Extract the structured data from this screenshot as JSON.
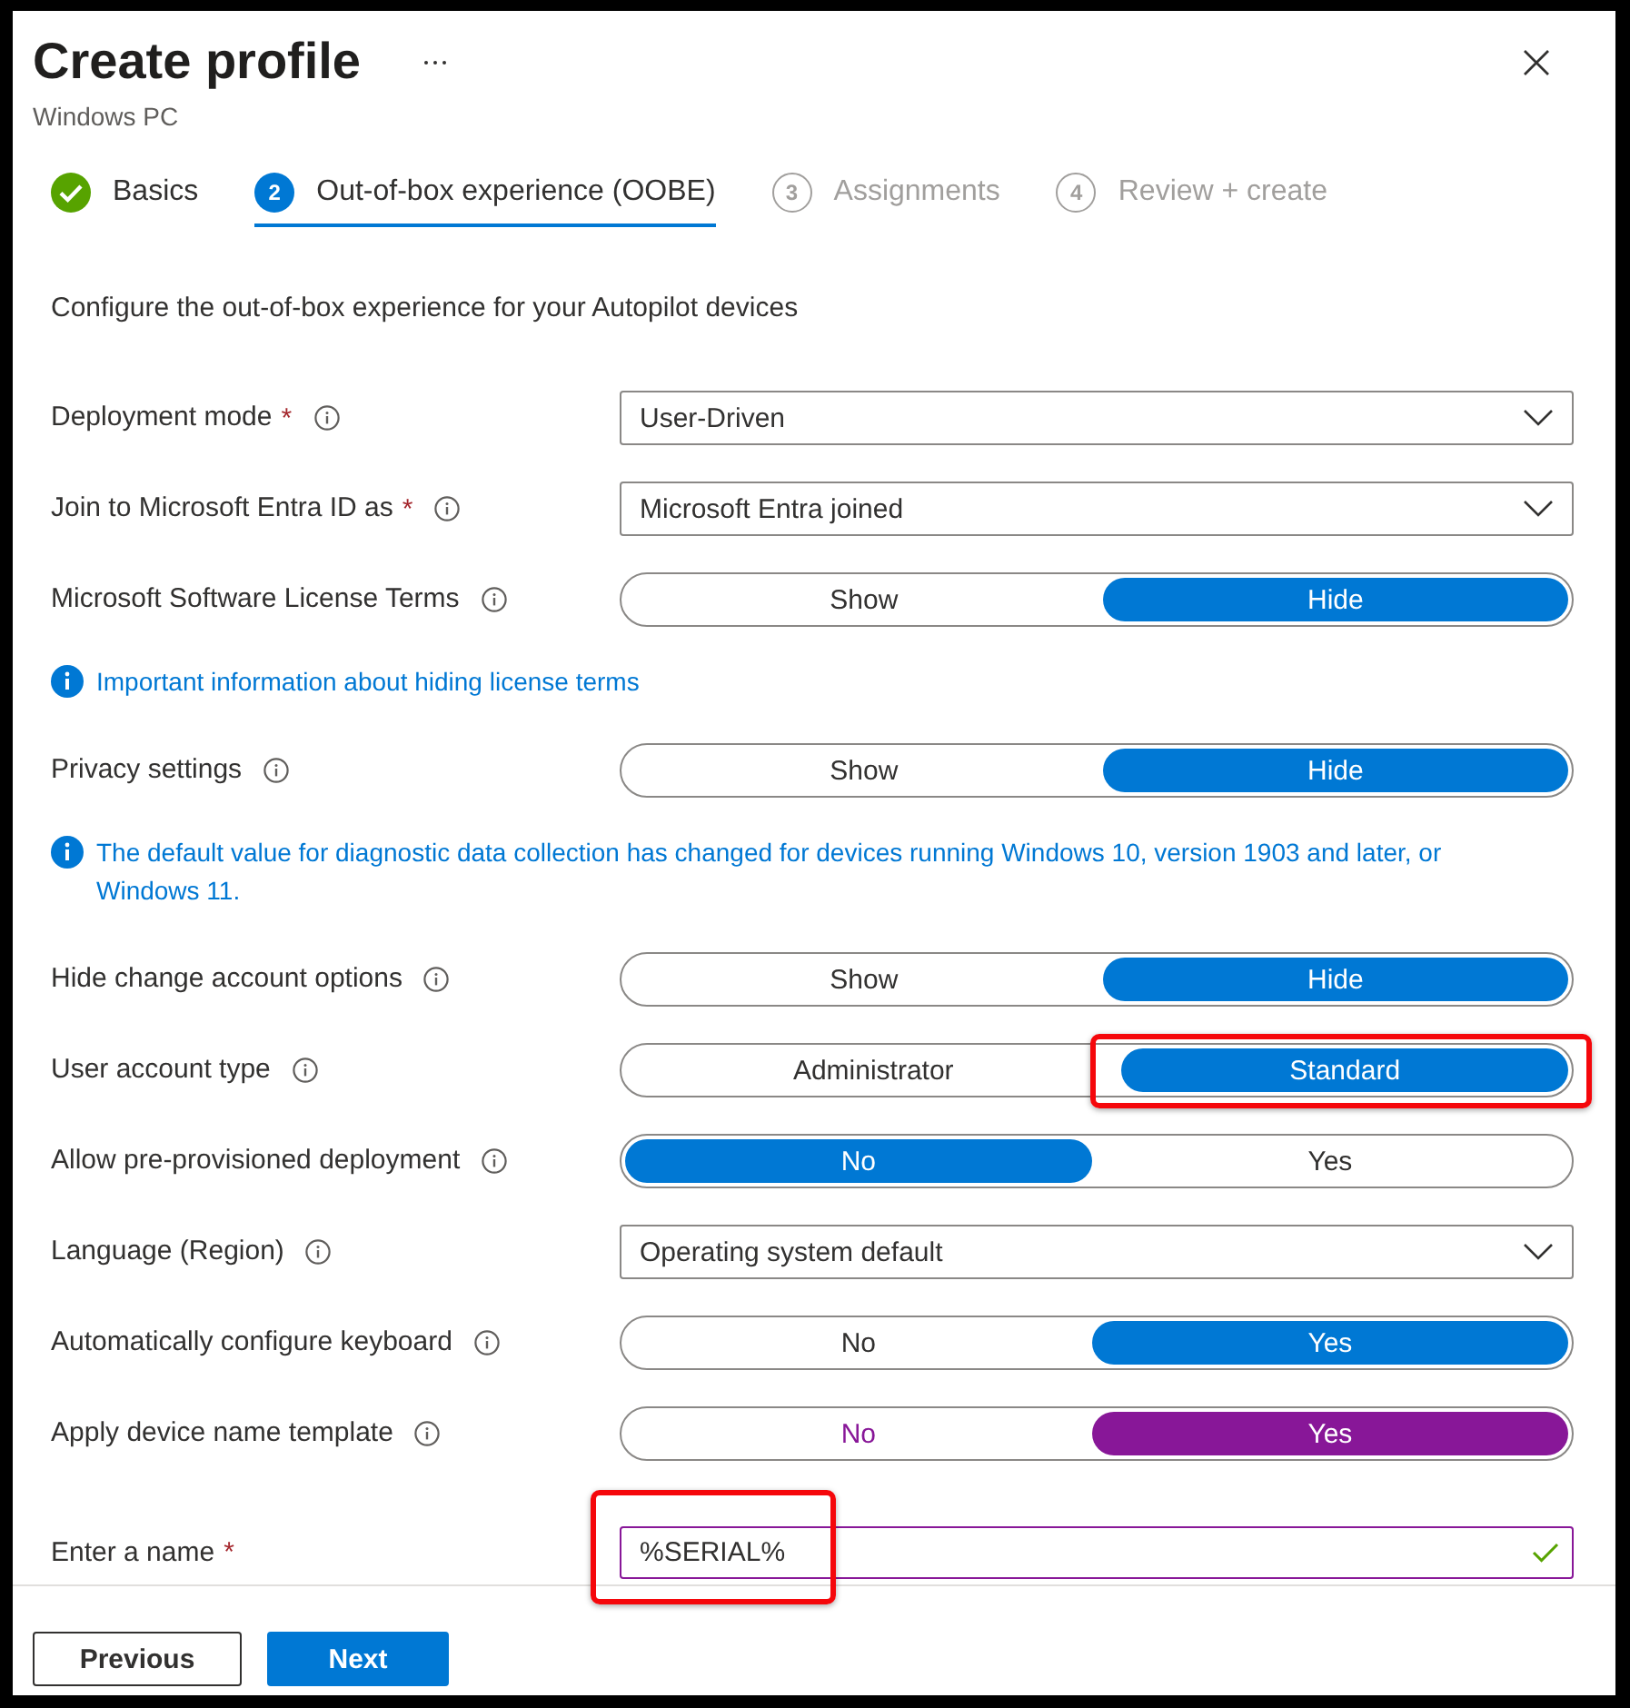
{
  "header": {
    "title": "Create profile",
    "subtitle": "Windows PC"
  },
  "steps": [
    {
      "label": "Basics",
      "completed": true,
      "selected": false,
      "disabled": false
    },
    {
      "number": "2",
      "label": "Out-of-box experience (OOBE)",
      "completed": false,
      "selected": true,
      "disabled": false
    },
    {
      "number": "3",
      "label": "Assignments",
      "completed": false,
      "selected": false,
      "disabled": true
    },
    {
      "number": "4",
      "label": "Review + create",
      "completed": false,
      "selected": false,
      "disabled": true
    }
  ],
  "intro": "Configure the out-of-box experience for your Autopilot devices",
  "settings": [
    {
      "kind": "dropdown",
      "label": "Deployment mode",
      "required_mark": "*",
      "has_info": true,
      "value": "User-Driven",
      "modified": false,
      "highlighted": false
    },
    {
      "kind": "dropdown",
      "label": "Join to Microsoft Entra ID as",
      "required_mark": "*",
      "has_info": true,
      "value": "Microsoft Entra joined",
      "modified": false,
      "highlighted": false
    },
    {
      "kind": "toggle",
      "label": "Microsoft Software License Terms",
      "has_info": true,
      "options": [
        {
          "label": "Show",
          "selected": false
        },
        {
          "label": "Hide",
          "selected": true
        }
      ],
      "modified": false,
      "highlighted": false
    },
    {
      "kind": "notice",
      "text": "Important information about hiding license terms"
    },
    {
      "kind": "toggle",
      "label": "Privacy settings",
      "has_info": true,
      "options": [
        {
          "label": "Show",
          "selected": false
        },
        {
          "label": "Hide",
          "selected": true
        }
      ],
      "modified": false,
      "highlighted": false
    },
    {
      "kind": "notice",
      "text": "The default value for diagnostic data collection has changed for devices running Windows 10, version 1903 and later, or Windows 11."
    },
    {
      "kind": "toggle",
      "label": "Hide change account options",
      "has_info": true,
      "options": [
        {
          "label": "Show",
          "selected": false
        },
        {
          "label": "Hide",
          "selected": true
        }
      ],
      "modified": false,
      "highlighted": false
    },
    {
      "kind": "toggle",
      "label": "User account type",
      "has_info": true,
      "options": [
        {
          "label": "Administrator",
          "selected": false
        },
        {
          "label": "Standard",
          "selected": true
        }
      ],
      "modified": false,
      "highlighted": true
    },
    {
      "kind": "toggle",
      "label": "Allow pre-provisioned deployment",
      "has_info": true,
      "options": [
        {
          "label": "No",
          "selected": true
        },
        {
          "label": "Yes",
          "selected": false
        }
      ],
      "modified": false,
      "highlighted": false
    },
    {
      "kind": "dropdown",
      "label": "Language (Region)",
      "has_info": true,
      "value": "Operating system default",
      "modified": false,
      "highlighted": false
    },
    {
      "kind": "toggle",
      "label": "Automatically configure keyboard",
      "has_info": true,
      "options": [
        {
          "label": "No",
          "selected": false
        },
        {
          "label": "Yes",
          "selected": true
        }
      ],
      "modified": false,
      "highlighted": false
    },
    {
      "kind": "toggle",
      "label": "Apply device name template",
      "has_info": true,
      "options": [
        {
          "label": "No",
          "selected": false
        },
        {
          "label": "Yes",
          "selected": true
        }
      ],
      "modified": true,
      "highlighted": false
    },
    {
      "kind": "text",
      "label": "Enter a name",
      "required_mark": "*",
      "has_info": false,
      "value": "%SERIAL%",
      "valid": true,
      "modified": true,
      "highlighted": true
    }
  ],
  "footer": {
    "buttons": [
      {
        "label": "Previous",
        "primary": false
      },
      {
        "label": "Next",
        "primary": true
      }
    ]
  }
}
